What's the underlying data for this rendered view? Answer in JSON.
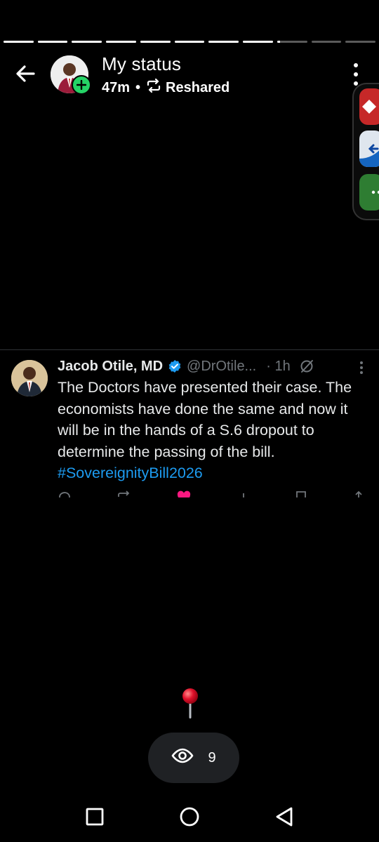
{
  "status": {
    "progress_segments": [
      1,
      1,
      1,
      1,
      1,
      1,
      1,
      1,
      0.1,
      0,
      0
    ],
    "title": "My status",
    "time_ago": "47m",
    "separator": "•",
    "reshared_label": "Reshared"
  },
  "tweet": {
    "author_name": "Jacob Otile, MD",
    "handle": "@DrOtile...",
    "time": "· 1h",
    "text": "The Doctors have presented their case. The economists have done the same and now it will be in the hands of a S.6 dropout to determine the passing of the bill. ",
    "hashtag": "#SovereignityBill2026"
  },
  "viewer": {
    "pin_emoji": "📍",
    "view_count": "9"
  },
  "colors": {
    "accent_green": "#25d366",
    "hashtag_blue": "#1d9bf0",
    "verified_blue": "#1d9bf0",
    "like_pink": "#f91880"
  }
}
